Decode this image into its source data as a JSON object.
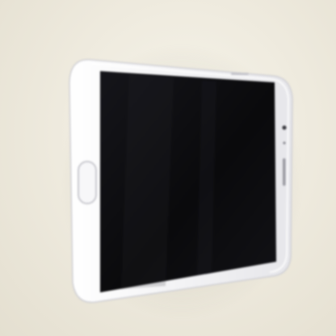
{
  "photo": {
    "subject": "smartphone-lying-face-up",
    "colors": {
      "surface": "#efebdf",
      "phone_body": "#f2f2f4",
      "phone_edge": "#cfcfd4",
      "screen": "#0b0b0d",
      "home_button_ring": "#d8d8dd"
    },
    "screen_state": "off"
  }
}
